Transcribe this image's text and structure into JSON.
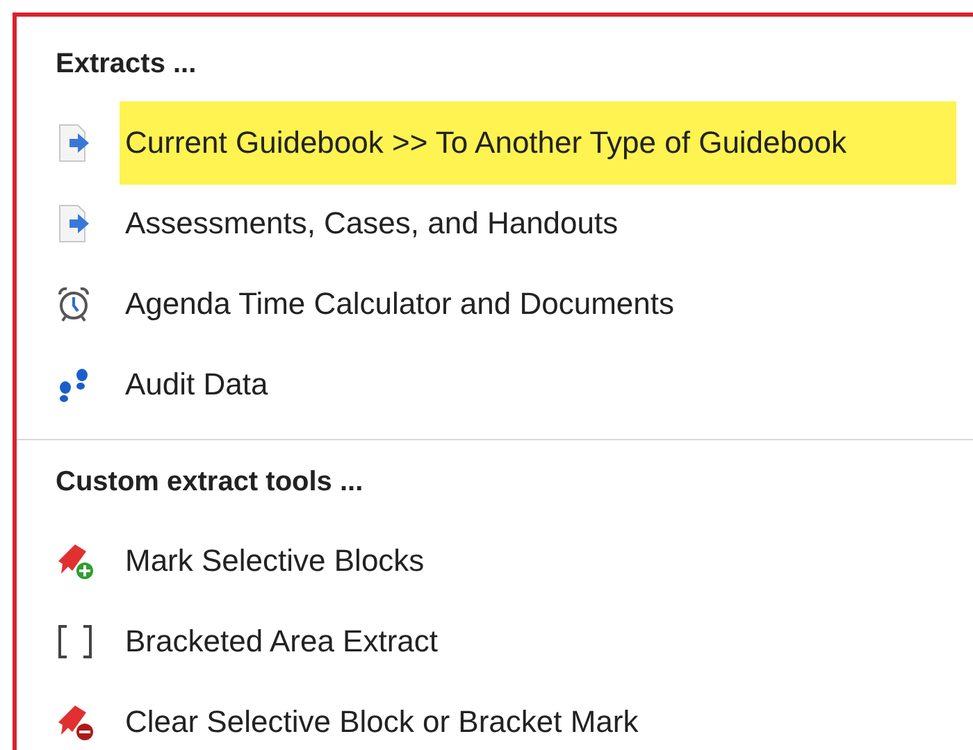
{
  "sections": [
    {
      "heading": "Extracts ...",
      "items": [
        {
          "kind": "document-arrow",
          "label": "Current Guidebook >> To Another Type of Guidebook",
          "highlighted": true
        },
        {
          "kind": "document-arrow",
          "label": "Assessments, Cases, and Handouts",
          "highlighted": false
        },
        {
          "kind": "alarm-clock",
          "label": "Agenda Time Calculator and Documents",
          "highlighted": false
        },
        {
          "kind": "footprints",
          "label": "Audit Data",
          "highlighted": false
        }
      ]
    },
    {
      "heading": "Custom extract tools ...",
      "items": [
        {
          "kind": "ribbon-plus",
          "label": "Mark Selective Blocks",
          "highlighted": false
        },
        {
          "kind": "brackets",
          "label": "Bracketed Area Extract",
          "highlighted": false
        },
        {
          "kind": "ribbon-minus",
          "label": "Clear Selective Block or Bracket Mark",
          "highlighted": false
        }
      ]
    }
  ]
}
